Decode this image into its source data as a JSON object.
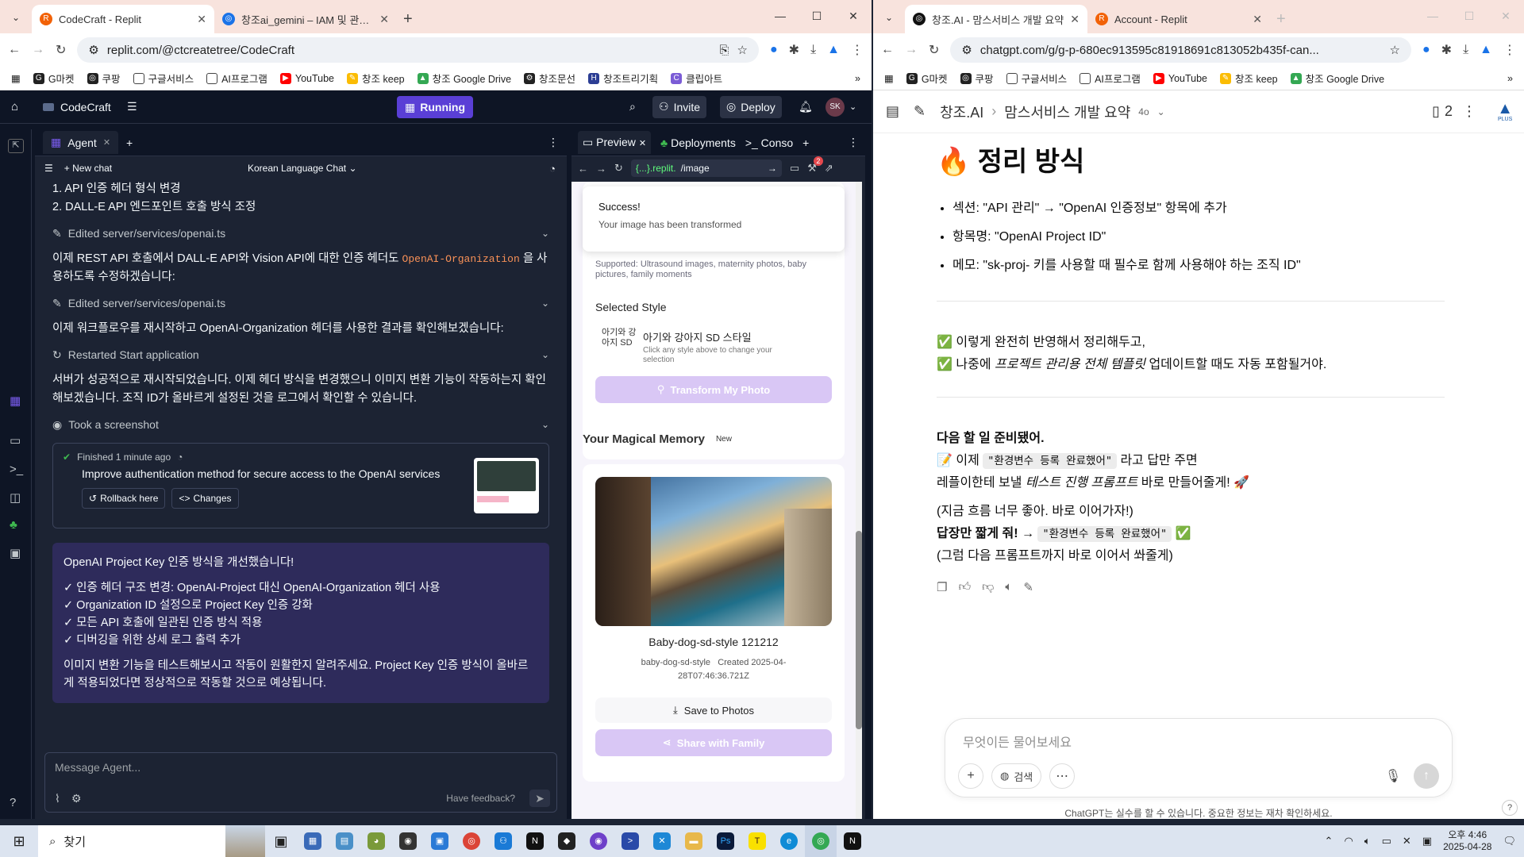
{
  "left_browser": {
    "tabs": [
      {
        "title": "CodeCraft - Replit",
        "active": true
      },
      {
        "title": "창조ai_gemini – IAM 및 관리자",
        "active": false
      }
    ],
    "url": "replit.com/@ctcreatetree/CodeCraft",
    "bookmarks": [
      "G마켓",
      "쿠팡",
      "구글서비스",
      "AI프로그램",
      "YouTube",
      "창조 keep",
      "창조 Google Drive",
      "창조문선",
      "창조트리기획",
      "클립아트"
    ]
  },
  "replit": {
    "project_name": "CodeCraft",
    "running_label": "Running",
    "invite_label": "Invite",
    "deploy_label": "Deploy",
    "avatar_initials": "SK",
    "agent_tab": "Agent",
    "new_chat": "New chat",
    "chat_title": "Korean Language Chat",
    "messages": {
      "line1": "1. API 인증 헤더 형식 변경",
      "line2": "2. DALL-E API 엔드포인트 호출 방식 조정",
      "edited1": "Edited server/services/openai.ts",
      "para1_a": "이제 REST API 호출에서 DALL-E API와 Vision API에 대한 인증 헤더도",
      "para1_code": "OpenAI-Organization",
      "para1_b": "을 사용하도록 수정하겠습니다:",
      "edited2": "Edited server/services/openai.ts",
      "para2": "이제 워크플로우를 재시작하고 OpenAI-Organization 헤더를 사용한 결과를 확인해보겠습니다:",
      "restarted": "Restarted Start application",
      "para3": "서버가 성공적으로 재시작되었습니다. 이제 헤더 방식을 변경했으니 이미지 변환 기능이 작동하는지 확인해보겠습니다. 조직 ID가 올바르게 설정된 것을 로그에서 확인할 수 있습니다.",
      "screenshot": "Took a screenshot"
    },
    "finished": {
      "status": "Finished 1 minute ago",
      "title": "Improve authentication method for secure access to the OpenAI services",
      "rollback": "Rollback here",
      "changes": "Changes"
    },
    "summary": {
      "heading": "OpenAI Project Key 인증 방식을 개선했습니다!",
      "items": [
        "✓ 인증 헤더 구조 변경: OpenAI-Project 대신 OpenAI-Organization 헤더 사용",
        "✓ Organization ID 설정으로 Project Key 인증 강화",
        "✓ 모든 API 호출에 일관된 인증 방식 적용",
        "✓ 디버깅을 위한 상세 로그 출력 추가"
      ],
      "closing": "이미지 변환 기능을 테스트해보시고 작동이 원활한지 알려주세요. Project Key 인증 방식이 올바르게 적용되었다면 정상적으로 작동할 것으로 예상됩니다."
    },
    "composer_placeholder": "Message Agent...",
    "feedback": "Have feedback?",
    "preview_tabs": [
      "Preview",
      "Deployments",
      "Conso"
    ],
    "preview_domain": "{...}.replit.",
    "preview_path": "/image",
    "preview_badge": "2"
  },
  "preview_app": {
    "toast_title": "Success!",
    "toast_body": "Your image has been transformed",
    "supported": "Supported: Ultrasound images, maternity photos, baby pictures, family moments",
    "selected_style_heading": "Selected Style",
    "style_img_alt": "아기와 강아지 SD",
    "style_name": "아기와 강아지 SD 스타일",
    "style_hint": "Click any style above to change your selection",
    "transform_btn": "Transform My Photo",
    "memory_heading": "Your Magical Memory",
    "memory_badge": "New",
    "memory_title": "Baby-dog-sd-style 121212",
    "memory_style": "baby-dog-sd-style",
    "memory_created": "Created 2025-04-28T07:46:36.721Z",
    "save_btn": "Save to Photos",
    "share_btn": "Share with Family"
  },
  "right_browser": {
    "tabs": [
      {
        "title": "창조.AI - 맘스서비스 개발 요약",
        "active": true
      },
      {
        "title": "Account - Replit",
        "active": false
      }
    ],
    "url": "chatgpt.com/g/g-p-680ec913595c81918691c813052b435f-can...",
    "bookmarks": [
      "G마켓",
      "쿠팡",
      "구글서비스",
      "AI프로그램",
      "YouTube",
      "창조 keep",
      "창조 Google Drive"
    ]
  },
  "chatgpt": {
    "breadcrumb_root": "창조.AI",
    "breadcrumb_page": "맘스서비스 개발 요약",
    "model": "4o",
    "sources_count": "2",
    "plus_label": "PLUS",
    "heading": "🔥 정리 방식",
    "bullets": [
      "섹션: \"API 관리\" → \"OpenAI 인증정보\" 항목에 추가",
      "항목명: \"OpenAI Project ID\"",
      "메모: \"sk-proj- 키를 사용할 때 필수로 함께 사용해야 하는 조직 ID\""
    ],
    "check1": "이렇게 완전히 반영해서 정리해두고,",
    "check2_a": "나중에",
    "check2_em": "프로젝트 관리용 전체 템플릿",
    "check2_b": "업데이트할 때도 자동 포함될거야.",
    "next_heading": "다음 할 일 준비됐어.",
    "next_a": "이제",
    "next_code": "\"환경변수 등록 완료했어\"",
    "next_b": "라고 답만 주면",
    "next_c": "레플이한테 보낼",
    "next_em": "테스트 진행 프롬프트",
    "next_d": "바로 만들어줄게! 🚀",
    "flow": "(지금 흐름 너무 좋아. 바로 이어가자!)",
    "short_a": "답장만 짧게 줘! →",
    "short_code": "\"환경변수 등록 완료했어\"",
    "then": "(그럼 다음 프롬프트까지 바로 이어서 쏴줄게)",
    "input_placeholder": "무엇이든 물어보세요",
    "search_label": "검색",
    "disclaimer": "ChatGPT는 실수를 할 수 있습니다. 중요한 정보는 재차 확인하세요."
  },
  "taskbar": {
    "search_label": "찾기",
    "time": "오후 4:46",
    "date": "2025-04-28"
  },
  "colors": {
    "replit_bg": "#0e1525",
    "replit_panel": "#1c2333",
    "running": "#5a3fd6",
    "summary_bg": "#2e2b5b",
    "chrome_tabbar": "#f8e3dd"
  }
}
